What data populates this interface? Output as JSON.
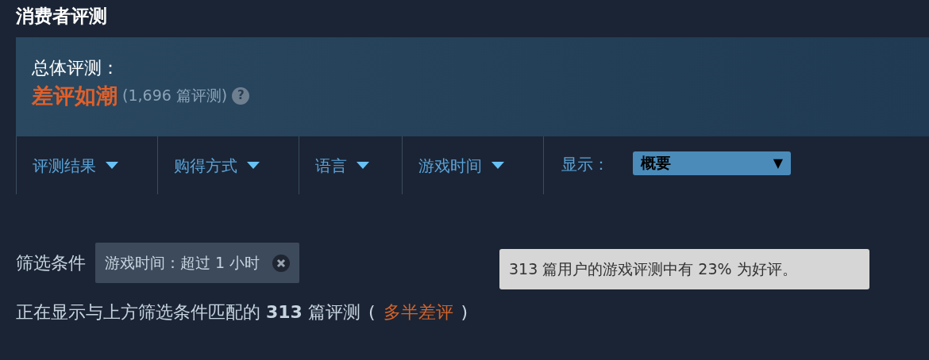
{
  "section_title": "消费者评测",
  "overall": {
    "label": "总体评测：",
    "rating": "差评如潮",
    "count": "(1,696 篇评测)",
    "help": "?"
  },
  "filters": [
    {
      "label": "评测结果"
    },
    {
      "label": "购得方式"
    },
    {
      "label": "语言"
    },
    {
      "label": "游戏时间"
    }
  ],
  "display": {
    "label": "显示：",
    "value": "概要",
    "arrow": "▼"
  },
  "active_filters": {
    "label": "筛选条件",
    "tags": [
      {
        "label": "游戏时间：超过 1 小时"
      }
    ]
  },
  "tooltip": "313 篇用户的游戏评测中有 23% 为好评。",
  "result": {
    "text": "正在显示与上方筛选条件匹配的 **313** 篇评测",
    "open": "(",
    "summary": "多半差评",
    "close": ")"
  }
}
